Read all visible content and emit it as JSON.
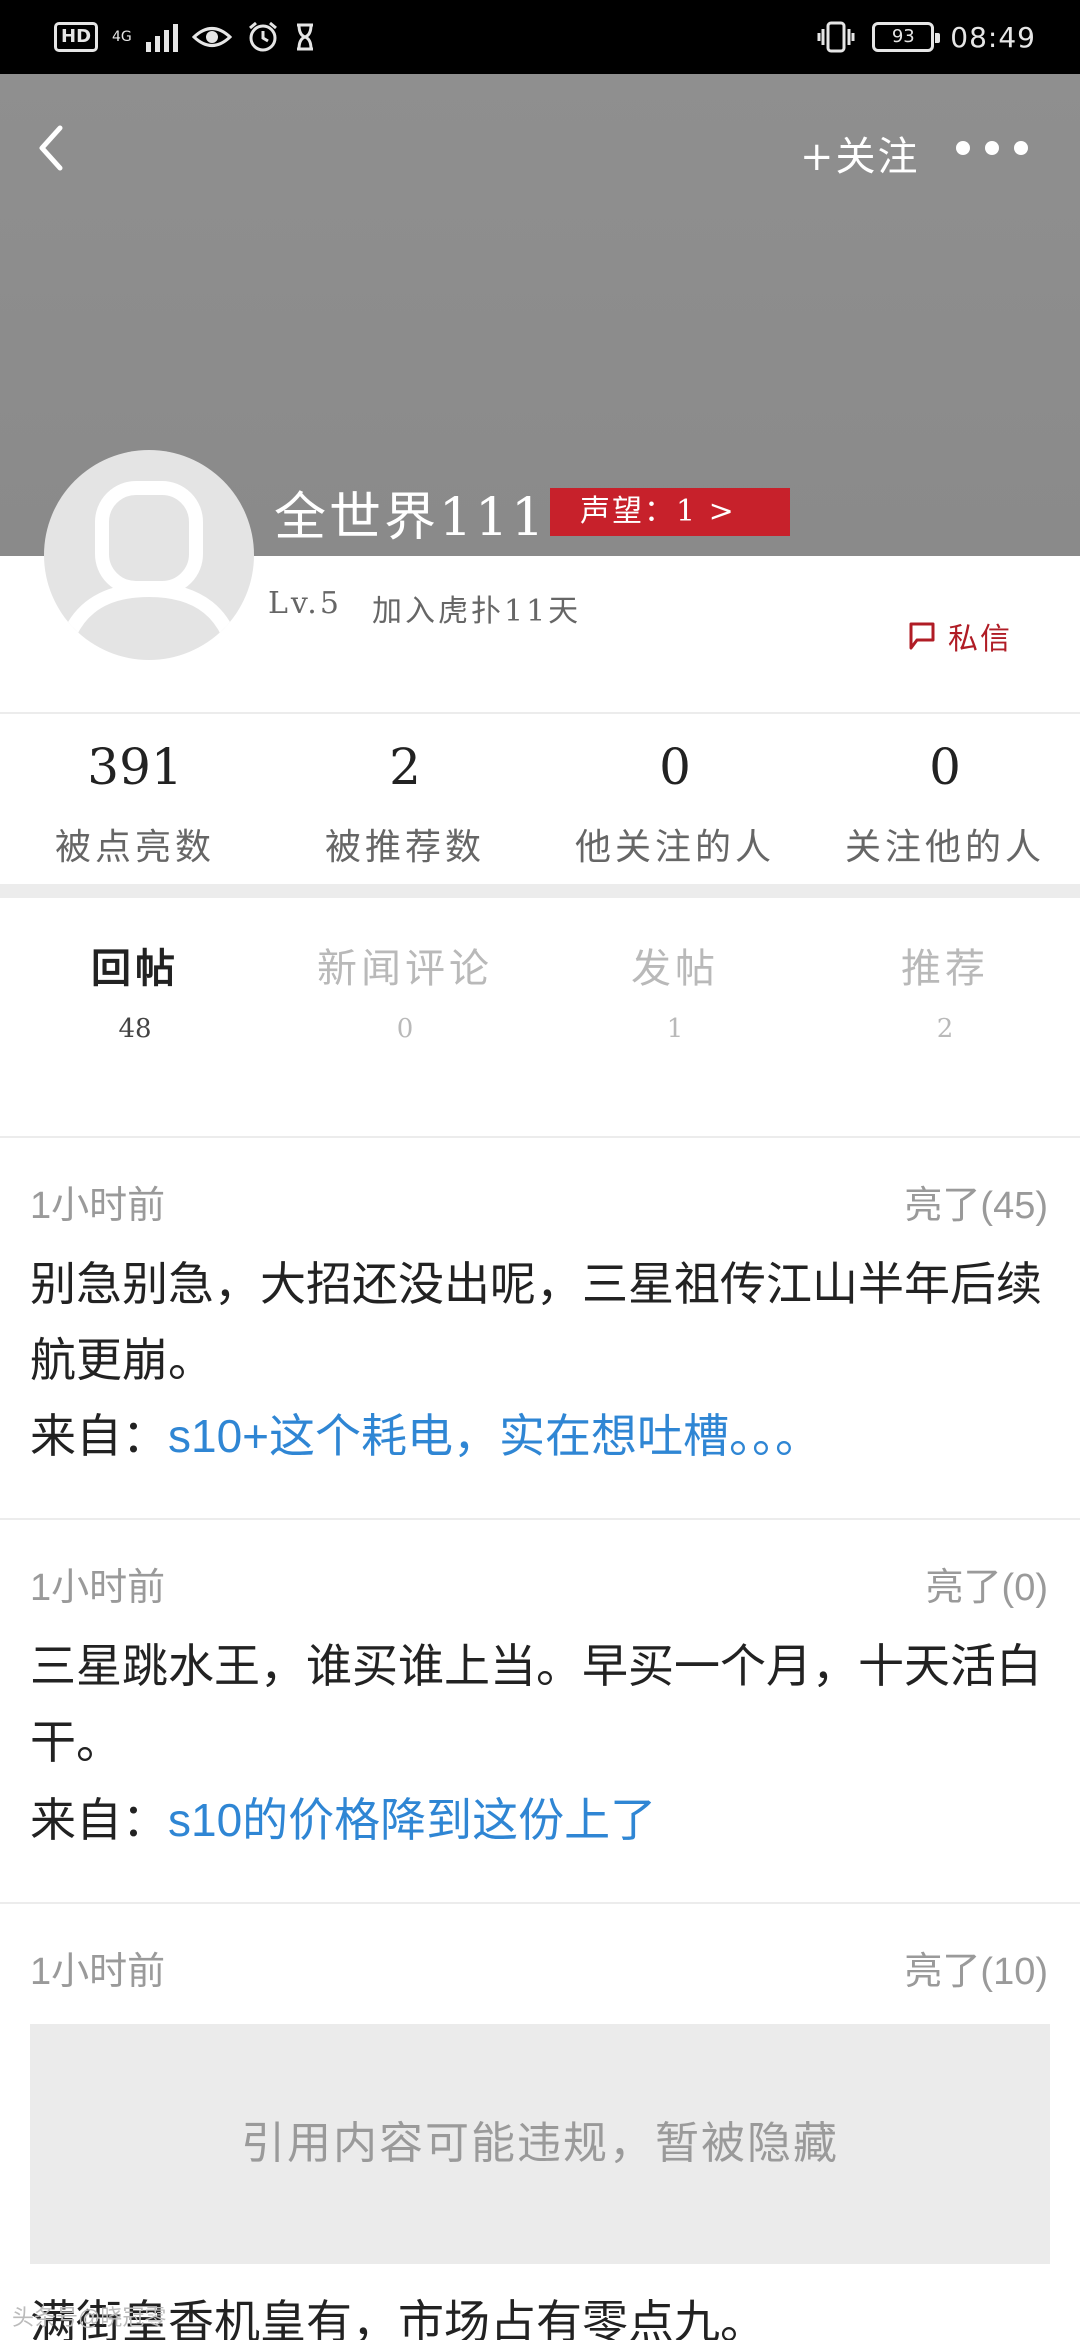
{
  "status_bar": {
    "hd": "HD",
    "network": "4G",
    "battery": "93",
    "time": "08:49"
  },
  "header": {
    "follow_label": "+关注",
    "username": "全世界111",
    "reputation": "声望：1 >",
    "level": "Lv.5",
    "joined": "加入虎扑11天",
    "dm_label": "私信"
  },
  "stats": [
    {
      "value": "391",
      "label": "被点亮数"
    },
    {
      "value": "2",
      "label": "被推荐数"
    },
    {
      "value": "0",
      "label": "他关注的人"
    },
    {
      "value": "0",
      "label": "关注他的人"
    }
  ],
  "tabs": [
    {
      "label": "回帖",
      "count": "48",
      "active": true
    },
    {
      "label": "新闻评论",
      "count": "0"
    },
    {
      "label": "发帖",
      "count": "1"
    },
    {
      "label": "推荐",
      "count": "2"
    }
  ],
  "posts": [
    {
      "time": "1小时前",
      "likes": "亮了(45)",
      "text": "别急别急，大招还没出呢，三星祖传江山半年后续航更崩。",
      "source_prefix": "来自：",
      "source_title": "s10+这个耗电，实在想吐槽。。。"
    },
    {
      "time": "1小时前",
      "likes": "亮了(0)",
      "text": "三星跳水王，谁买谁上当。早买一个月，十天活白干。",
      "source_prefix": "来自：",
      "source_title": "s10的价格降到这份上了"
    },
    {
      "time": "1小时前",
      "likes": "亮了(10)",
      "hidden_notice": "引用内容可能违规，暂被隐藏",
      "text": "满街皇香机皇有，市场占有零点九。"
    }
  ],
  "watermark": "头条号@晓冠零"
}
